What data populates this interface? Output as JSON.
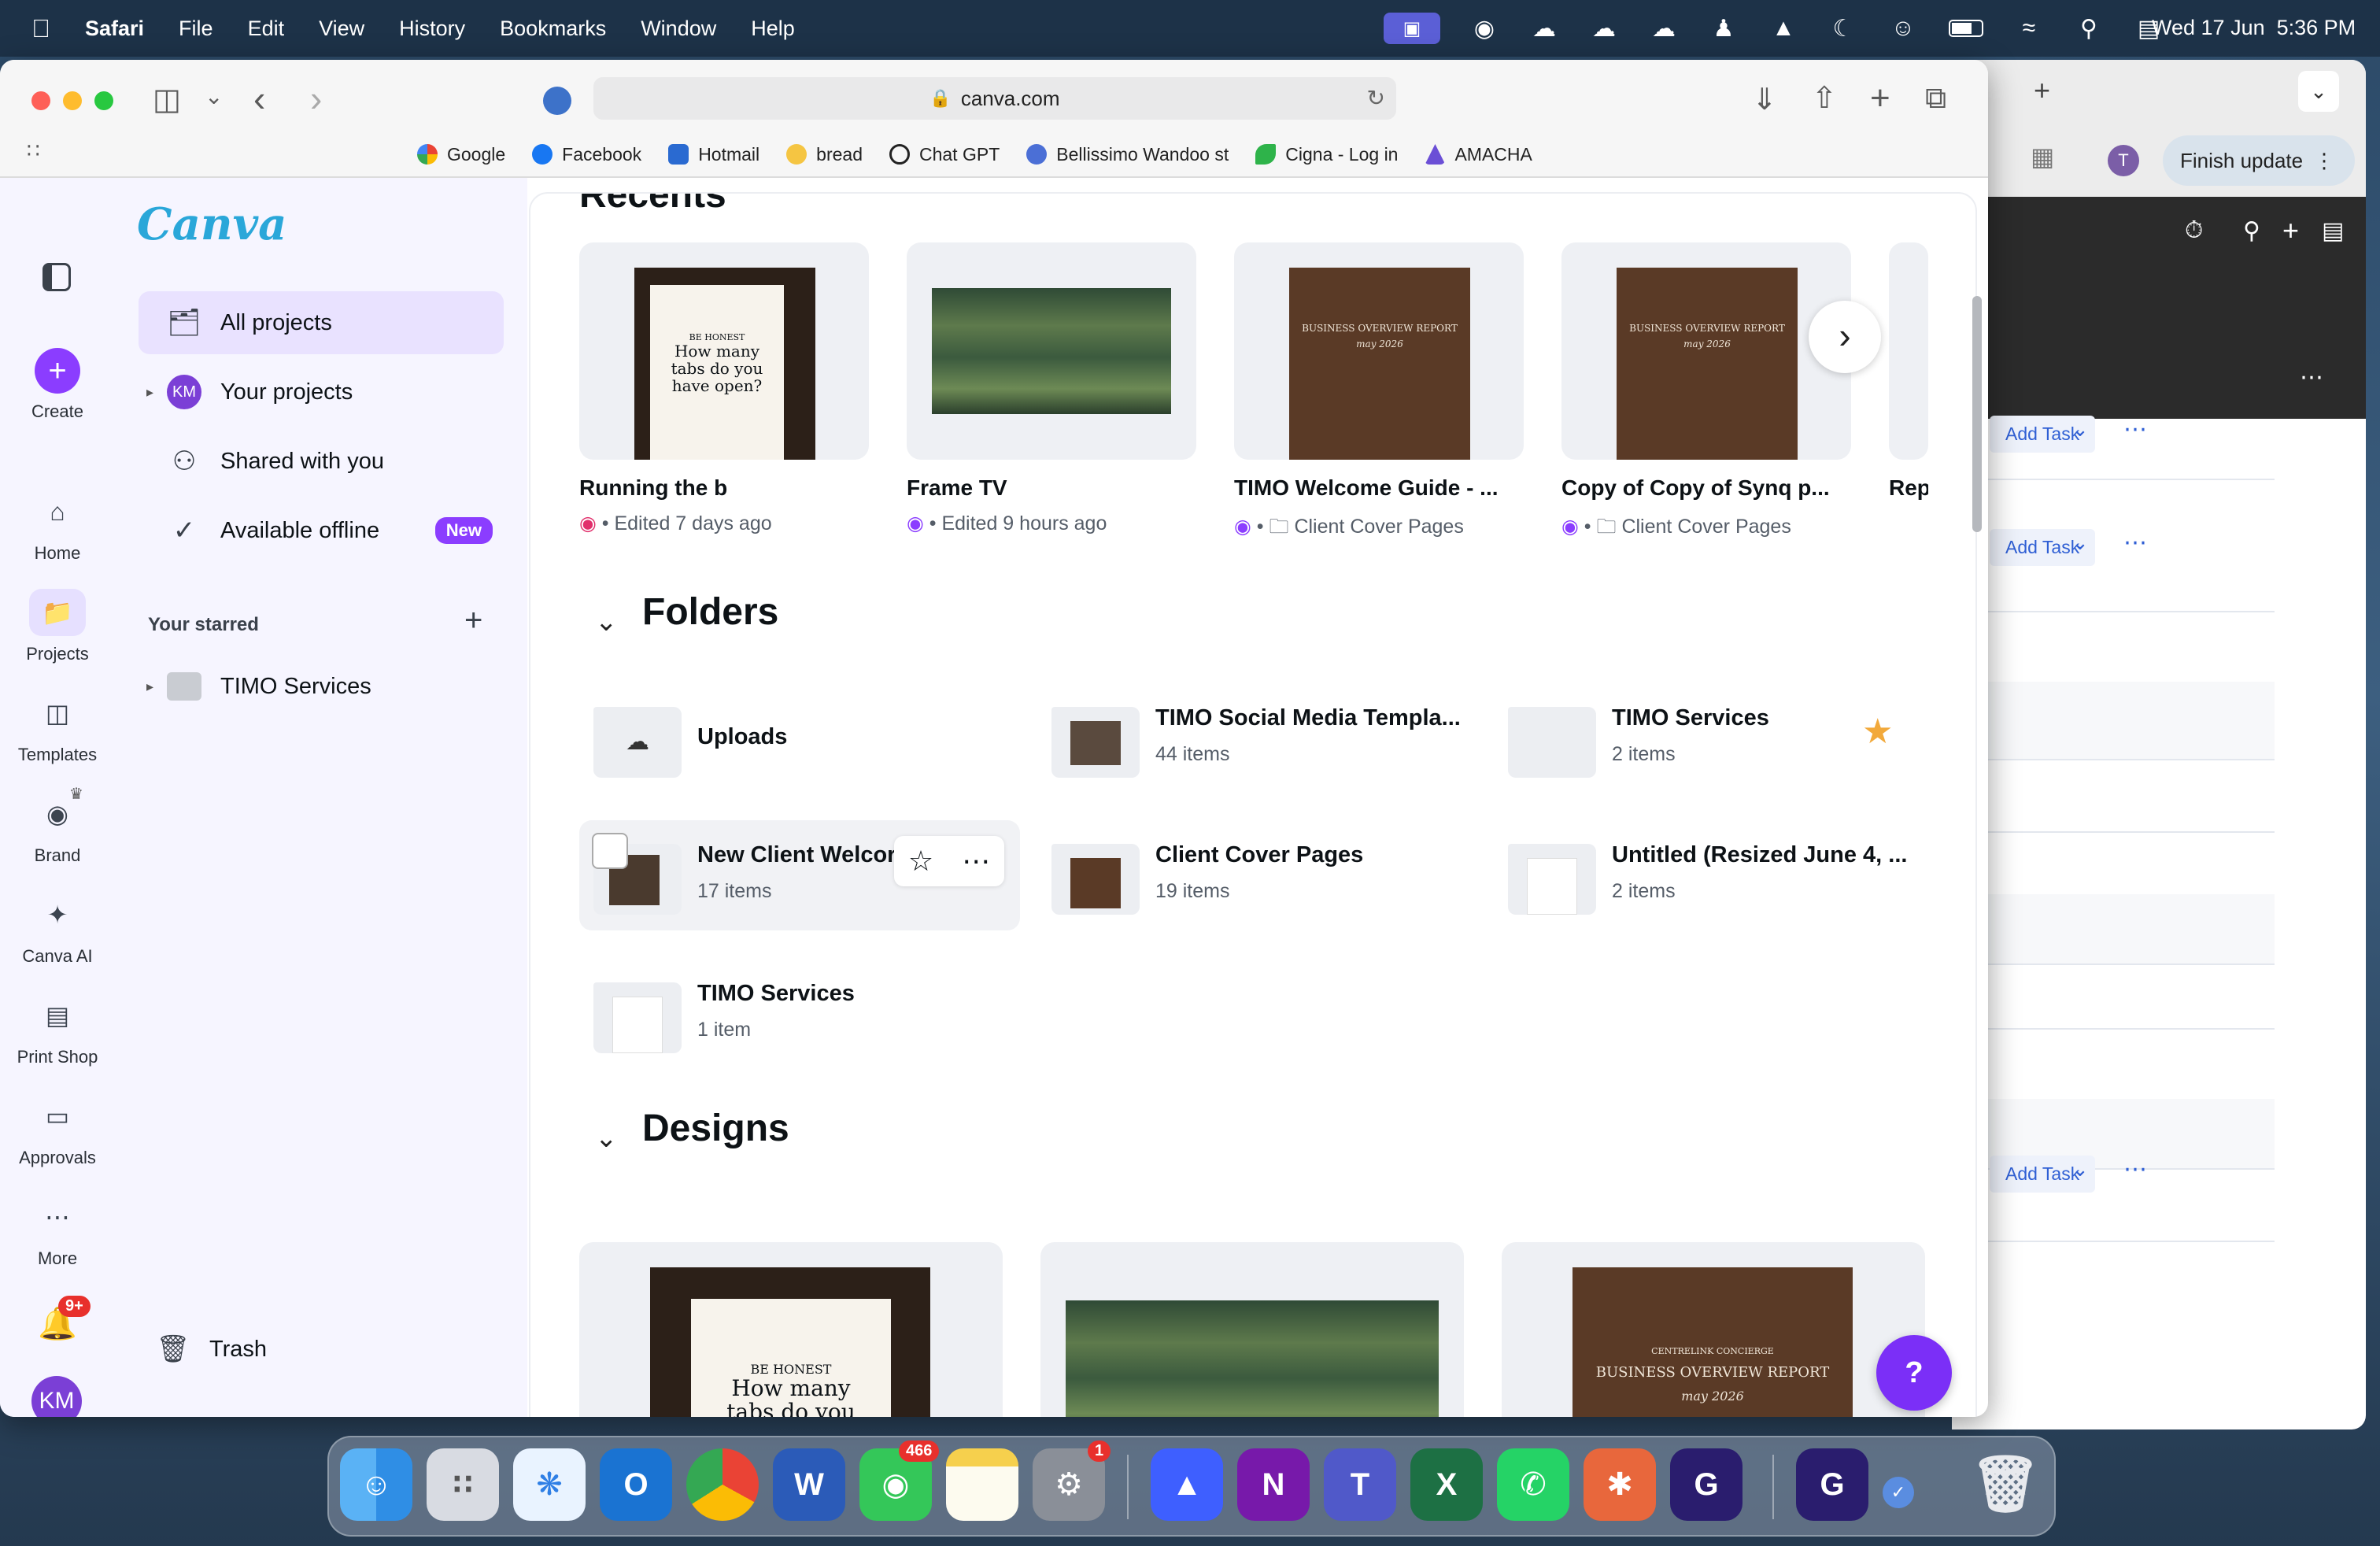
{
  "menubar": {
    "app": "Safari",
    "items": [
      "File",
      "Edit",
      "View",
      "History",
      "Bookmarks",
      "Window",
      "Help"
    ],
    "datetime": "Wed 17 Jun  5:36 PM"
  },
  "browser": {
    "url": "canva.com",
    "bookmarks": [
      "Google",
      "Facebook",
      "Hotmail",
      "bread",
      "Chat GPT",
      "Bellissimo Wandoo st",
      "Cigna - Log in",
      "AMACHA"
    ]
  },
  "bg_window": {
    "finish_update": "Finish update",
    "avatar": "T",
    "add_task": "Add Task"
  },
  "canva": {
    "logo": "Canva",
    "rail": [
      {
        "label": "Create",
        "icon": "plus-icon"
      },
      {
        "label": "Home",
        "icon": "home-icon"
      },
      {
        "label": "Projects",
        "icon": "folder-icon"
      },
      {
        "label": "Templates",
        "icon": "templates-icon"
      },
      {
        "label": "Brand",
        "icon": "brand-icon"
      },
      {
        "label": "Canva AI",
        "icon": "canva-ai-icon"
      },
      {
        "label": "Print Shop",
        "icon": "print-shop-icon"
      },
      {
        "label": "Approvals",
        "icon": "approvals-icon"
      },
      {
        "label": "More",
        "icon": "more-icon"
      }
    ],
    "notifications_badge": "9+",
    "avatar": "KM",
    "sidebar": {
      "all_projects": "All projects",
      "your_projects": "Your projects",
      "shared": "Shared with you",
      "offline": "Available offline",
      "new_badge": "New",
      "starred_title": "Your starred",
      "starred_item": "TIMO Services",
      "trash": "Trash"
    },
    "recents": {
      "title": "Recents",
      "items": [
        {
          "title": "Running the b",
          "meta": "• Edited 7 days ago",
          "thumb_lines": [
            "BE HONEST",
            "How many tabs do you have open?"
          ]
        },
        {
          "title": "Frame TV",
          "meta": "• Edited 9 hours ago"
        },
        {
          "title": "TIMO Welcome Guide - ...",
          "meta": "Client Cover Pages",
          "thumb_lines": [
            "BUSINESS OVERVIEW REPORT",
            "may 2026"
          ]
        },
        {
          "title": "Copy of Copy of Synq p...",
          "meta": "Client Cover Pages",
          "thumb_lines": [
            "BUSINESS OVERVIEW REPORT",
            "may 2026"
          ]
        },
        {
          "title": "Rep",
          "meta": ""
        }
      ]
    },
    "folders": {
      "title": "Folders",
      "items": [
        {
          "name": "Uploads",
          "count": ""
        },
        {
          "name": "TIMO Social Media Templa...",
          "count": "44 items"
        },
        {
          "name": "TIMO Services",
          "count": "2 items"
        },
        {
          "name": "New Client Welcor",
          "count": "17 items"
        },
        {
          "name": "Client Cover Pages",
          "count": "19 items"
        },
        {
          "name": "Untitled (Resized June 4, ...",
          "count": "2 items"
        },
        {
          "name": "TIMO Services",
          "count": "1 item"
        }
      ]
    },
    "designs": {
      "title": "Designs",
      "card1_lines": [
        "BE HONEST",
        "How many tabs do you have open?"
      ],
      "card3_lines": [
        "CENTRELINK CONCIERGE",
        "BUSINESS OVERVIEW REPORT",
        "may 2026"
      ]
    },
    "help": "?"
  },
  "dock": {
    "messages_badge": "466",
    "settings_badge": "1"
  }
}
